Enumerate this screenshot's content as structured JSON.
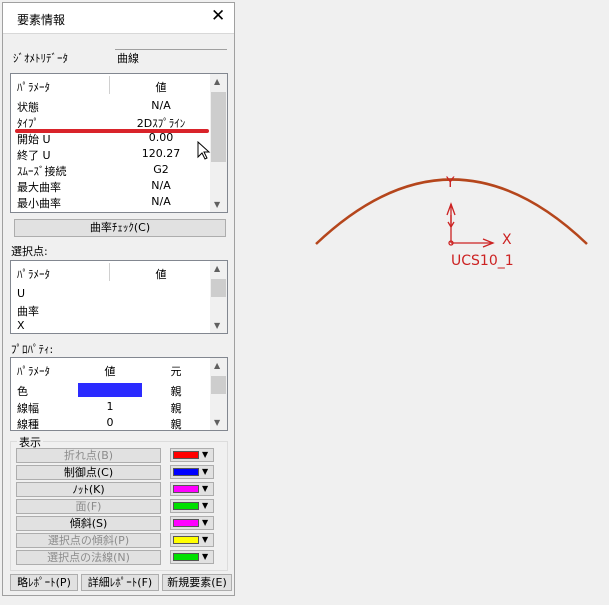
{
  "dialog": {
    "title": "要素情報",
    "geometry_label": "ｼﾞｵﾒﾄﾘﾃﾞｰﾀ",
    "geometry_value": "曲線",
    "params": {
      "headers": [
        "ﾊﾟﾗﾒｰﾀ",
        "値"
      ],
      "rows": [
        {
          "name": "状態",
          "value": "N/A"
        },
        {
          "name": "ﾀｲﾌﾟ",
          "value": "2Dｽﾌﾟﾗｲﾝ"
        },
        {
          "name": "開始 U",
          "value": "0.00"
        },
        {
          "name": "終了 U",
          "value": "120.27"
        },
        {
          "name": "ｽﾑｰｽﾞ接続",
          "value": "G2"
        },
        {
          "name": "最大曲率",
          "value": "N/A"
        },
        {
          "name": "最小曲率",
          "value": "N/A"
        }
      ]
    },
    "curvature_check": "曲率ﾁｪｯｸ(C)",
    "selection_label": "選択点:",
    "selection": {
      "headers": [
        "ﾊﾟﾗﾒｰﾀ",
        "値"
      ],
      "rows": [
        "U",
        "曲率",
        "X"
      ]
    },
    "property_label": "ﾌﾟﾛﾊﾟﾃｨ:",
    "property": {
      "headers": [
        "ﾊﾟﾗﾒｰﾀ",
        "値",
        "元"
      ],
      "rows": [
        {
          "name": "色",
          "value": "",
          "source": "親",
          "color": "#2b2bff"
        },
        {
          "name": "線幅",
          "value": "1",
          "source": "親"
        },
        {
          "name": "線種",
          "value": "0",
          "source": "親"
        }
      ]
    },
    "display_label": "表示",
    "display_items": [
      {
        "label": "折れ点(B)",
        "enabled": false,
        "color": "#ff0000"
      },
      {
        "label": "制御点(C)",
        "enabled": true,
        "color": "#0000ff"
      },
      {
        "label": "ﾉｯﾄ(K)",
        "enabled": true,
        "color": "#ff00ff"
      },
      {
        "label": "面(F)",
        "enabled": false,
        "color": "#00e000"
      },
      {
        "label": "傾斜(S)",
        "enabled": true,
        "color": "#ff00ff"
      },
      {
        "label": "選択点の傾斜(P)",
        "enabled": false,
        "color": "#ffff00"
      },
      {
        "label": "選択点の法線(N)",
        "enabled": false,
        "color": "#00e000"
      }
    ],
    "footer": [
      "略ﾚﾎﾟｰﾄ(P)",
      "詳細ﾚﾎﾟｰﾄ(F)",
      "新規要素(E)"
    ]
  },
  "viewport": {
    "axis_x": "X",
    "axis_y": "Y",
    "ucs_label": "UCS10_1",
    "curve_color": "#b5461c",
    "axis_color": "#cc2222"
  }
}
